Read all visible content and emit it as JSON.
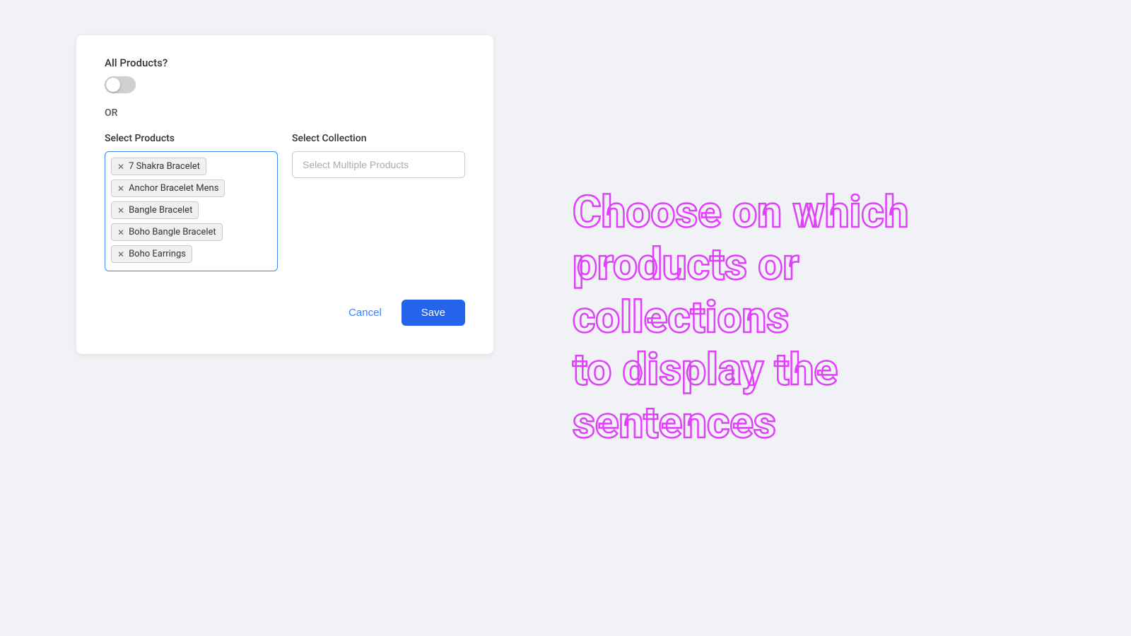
{
  "left": {
    "all_products_label": "All Products?",
    "toggle_state": "off",
    "or_label": "OR",
    "select_products": {
      "label": "Select Products",
      "tags": [
        {
          "id": "tag-1",
          "label": "7 Shakra Bracelet"
        },
        {
          "id": "tag-2",
          "label": "Anchor Bracelet Mens"
        },
        {
          "id": "tag-3",
          "label": "Bangle Bracelet"
        },
        {
          "id": "tag-4",
          "label": "Boho Bangle Bracelet"
        },
        {
          "id": "tag-5",
          "label": "Boho Earrings"
        }
      ]
    },
    "select_collection": {
      "label": "Select Collection",
      "placeholder": "Select Multiple Products"
    },
    "cancel_label": "Cancel",
    "save_label": "Save"
  },
  "right": {
    "promo_line1": "Choose on which",
    "promo_line2": "products or collections",
    "promo_line3": "to display the",
    "promo_line4": "sentences"
  },
  "colors": {
    "accent_blue": "#2563eb",
    "cancel_blue": "#3b82f6",
    "promo_pink": "#e040fb",
    "toggle_off": "#d0d0d0"
  }
}
